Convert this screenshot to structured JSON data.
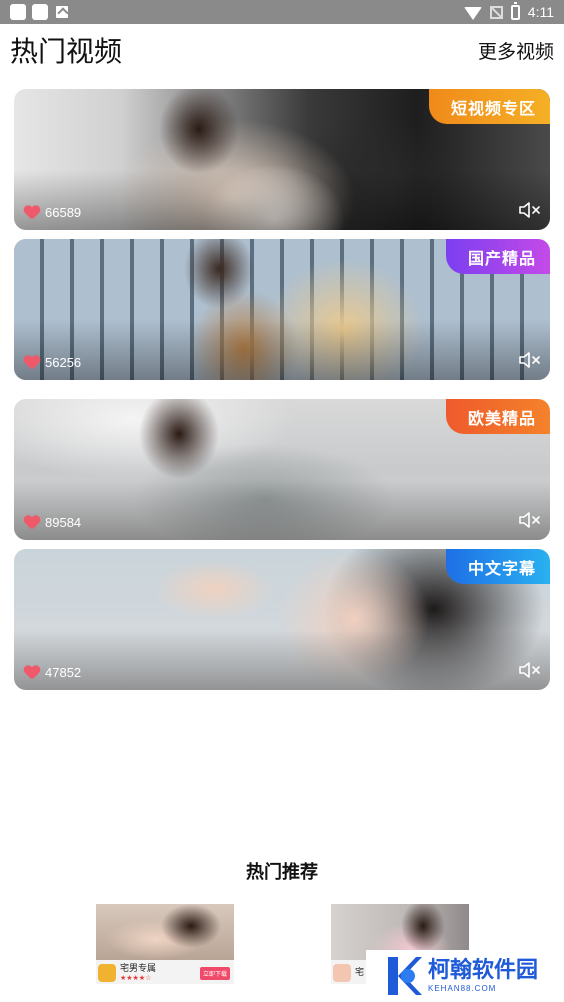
{
  "status_bar": {
    "time": "4:11",
    "icons": [
      "app-icon",
      "app-icon",
      "text-a-icon",
      "wifi-icon",
      "no-signal-icon",
      "battery-icon"
    ]
  },
  "header": {
    "title": "热门视频",
    "more_label": "更多视频"
  },
  "videos": [
    {
      "badge": "短视频专区",
      "likes": "66589",
      "badge_colors": [
        "#f08a1a",
        "#f5b025"
      ],
      "mute_icon": "mute-icon"
    },
    {
      "badge": "国产精品",
      "likes": "56256",
      "badge_colors": [
        "#7b3ff0",
        "#c44ae8"
      ],
      "mute_icon": "mute-icon"
    },
    {
      "badge": "欧美精品",
      "likes": "89584",
      "badge_colors": [
        "#ee5a2c",
        "#f5822a"
      ],
      "mute_icon": "mute-icon"
    },
    {
      "badge": "中文字幕",
      "likes": "47852",
      "badge_colors": [
        "#1e6fe6",
        "#2ab1f0"
      ],
      "mute_icon": "mute-icon"
    }
  ],
  "recommend": {
    "title": "热门推荐",
    "apps": [
      {
        "name": "宅男专属",
        "stars": "★★★★☆",
        "download_label": "立即下载"
      },
      {
        "name": "宅",
        "stars": "",
        "download_label": ""
      }
    ]
  },
  "watermark": {
    "name": "柯翰软件园",
    "url": "KEHAN88.COM"
  },
  "colors": {
    "status_bar": "#8a8a8a",
    "heart": "#ef5a6a",
    "watermark_blue": "#1f5bd8"
  }
}
